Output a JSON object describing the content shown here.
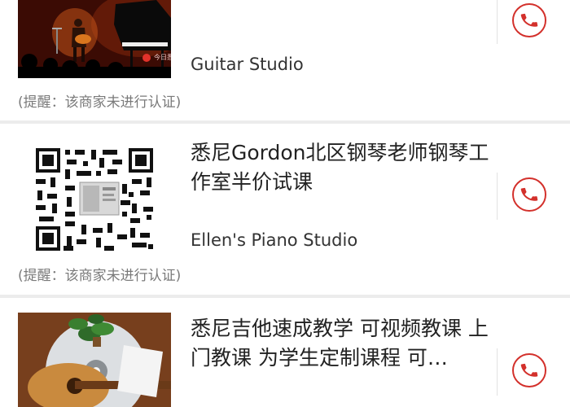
{
  "listings": [
    {
      "title": "",
      "studio": "Guitar Studio",
      "note": "(提醒：该商家未进行认证)",
      "thumb_watermark": "今日悉尼"
    },
    {
      "title": "悉尼Gordon北区钢琴老师钢琴工作室半价试课",
      "studio": "Ellen's Piano Studio",
      "note": "(提醒：该商家未进行认证)"
    },
    {
      "title": "悉尼吉他速成教学 可视频教课 上门教课 为学生定制课程 可…",
      "studio": "",
      "note": ""
    }
  ],
  "icons": {
    "call": "phone-call-icon"
  },
  "colors": {
    "accent": "#d3302b",
    "note": "#7a7a7a",
    "divider": "#ececec"
  }
}
